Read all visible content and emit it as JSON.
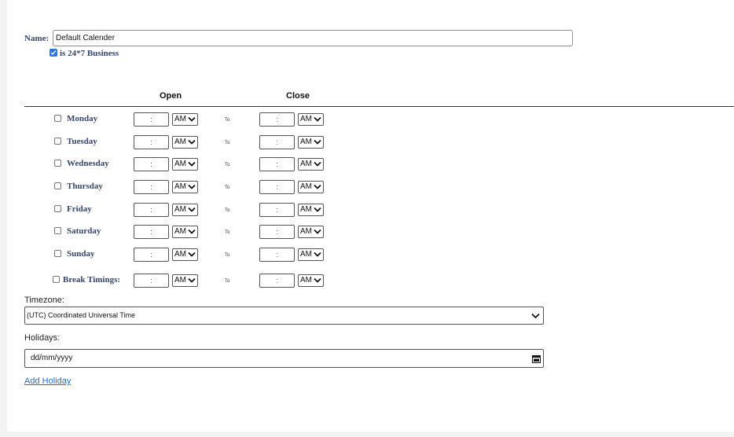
{
  "name": {
    "label": "Name:",
    "value": "Default Calender"
  },
  "is247": {
    "label": "is 24*7 Business",
    "checked": true
  },
  "columns": {
    "open": "Open",
    "close": "Close"
  },
  "days": [
    {
      "label": "Monday",
      "open_time": ":",
      "open_ampm": "AM",
      "to": "To",
      "close_time": ":",
      "close_ampm": "AM"
    },
    {
      "label": "Tuesday",
      "open_time": ":",
      "open_ampm": "AM",
      "to": "To",
      "close_time": ":",
      "close_ampm": "AM"
    },
    {
      "label": "Wednesday",
      "open_time": ":",
      "open_ampm": "AM",
      "to": "To",
      "close_time": ":",
      "close_ampm": "AM"
    },
    {
      "label": "Thursday",
      "open_time": ":",
      "open_ampm": "AM",
      "to": "To",
      "close_time": ":",
      "close_ampm": "AM"
    },
    {
      "label": "Friday",
      "open_time": ":",
      "open_ampm": "AM",
      "to": "To",
      "close_time": ":",
      "close_ampm": "AM"
    },
    {
      "label": "Saturday",
      "open_time": ":",
      "open_ampm": "AM",
      "to": "To",
      "close_time": ":",
      "close_ampm": "AM"
    },
    {
      "label": "Sunday",
      "open_time": ":",
      "open_ampm": "AM",
      "to": "To",
      "close_time": ":",
      "close_ampm": "AM"
    }
  ],
  "break": {
    "label": "Break Timings:",
    "open_time": ":",
    "open_ampm": "AM",
    "to": "To",
    "close_time": ":",
    "close_ampm": "AM"
  },
  "timezone": {
    "label": "Timezone:",
    "value": "(UTC) Coordinated Universal Time"
  },
  "holidays": {
    "label": "Holidays:",
    "placeholder": "dd/mm/yyyy"
  },
  "add_holiday": "Add Holiday ",
  "colors": {
    "label_text": "#34466b",
    "link": "#1f6fd1",
    "checkbox_checked": "#2a77e1"
  }
}
